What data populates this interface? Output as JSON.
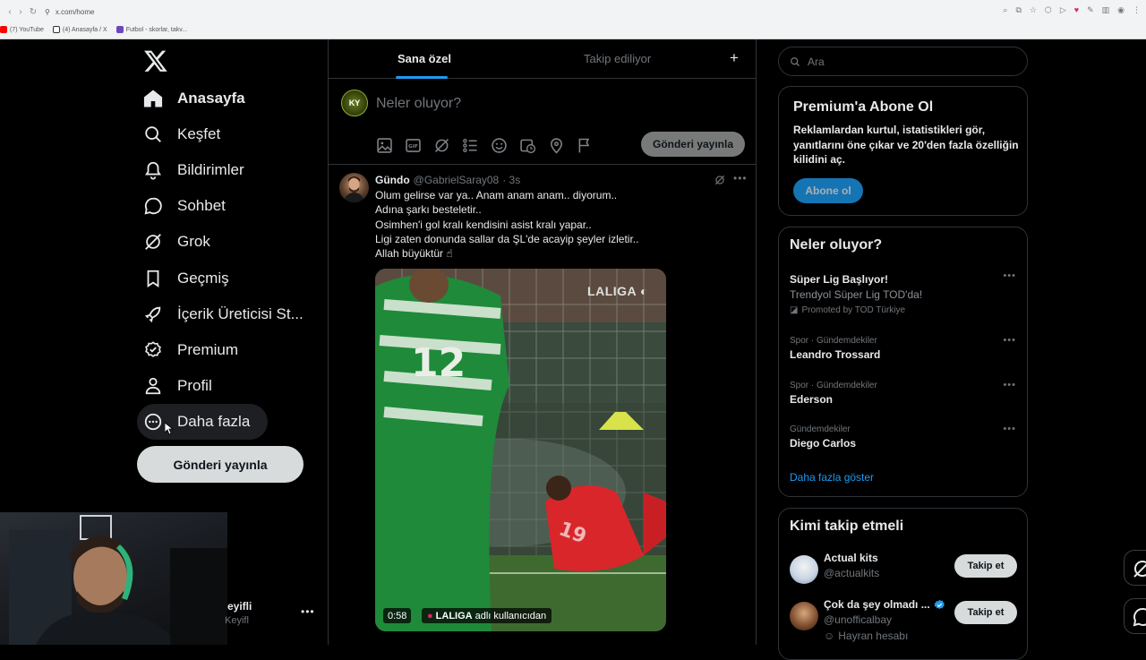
{
  "browser": {
    "url": "x.com/home",
    "bookmarks": [
      {
        "label": "(7) YouTube",
        "color": "#ff0000"
      },
      {
        "label": "(4) Anasayfa / X",
        "color": "#ffffff"
      },
      {
        "label": "Futbol - skorlar, takv...",
        "color": "#6b46c1"
      }
    ]
  },
  "sidebar": {
    "items": [
      {
        "label": "Anasayfa",
        "icon": "home-icon"
      },
      {
        "label": "Keşfet",
        "icon": "search-icon"
      },
      {
        "label": "Bildirimler",
        "icon": "bell-icon"
      },
      {
        "label": "Sohbet",
        "icon": "chat-icon"
      },
      {
        "label": "Grok",
        "icon": "grok-icon"
      },
      {
        "label": "Geçmiş",
        "icon": "bookmark-icon"
      },
      {
        "label": "İçerik Üreticisi St...",
        "icon": "rocket-icon"
      },
      {
        "label": "Premium",
        "icon": "verified-icon"
      },
      {
        "label": "Profil",
        "icon": "person-icon"
      },
      {
        "label": "Daha fazla",
        "icon": "more-circle-icon"
      }
    ],
    "post_button": "Gönderi yayınla",
    "account": {
      "name": "eyifli",
      "handle": "Keyifl"
    }
  },
  "feed": {
    "tabs": [
      "Sana özel",
      "Takip ediliyor"
    ],
    "active_tab": 0,
    "compose": {
      "avatar_text": "KY",
      "placeholder": "Neler oluyor?",
      "post_button": "Gönderi yayınla"
    },
    "tweet": {
      "name": "Gündo",
      "handle": "@GabrielSaray08",
      "time": "· 3s",
      "text": "Olum gelirse var ya.. Anam anam anam.. diyorum..\nAdına şarkı besteletir..\nOsimhen'i gol kralı kendisini asist kralı yapar..\nLigi zaten donunda sallar da ŞL'de acayip şeyler izletir..\nAllah büyüktür ☝",
      "video": {
        "watermark": "LALIGA",
        "duration": "0:58",
        "source_brand": "LALIGA",
        "source_suffix": "adlı kullanıcıdan"
      }
    }
  },
  "right": {
    "search_placeholder": "Ara",
    "premium": {
      "title": "Premium'a Abone Ol",
      "description": "Reklamlardan kurtul, istatistikleri gör, yanıtlarını öne çıkar ve 20'den fazla özelliğin kilidini aç.",
      "button": "Abone ol"
    },
    "trends": {
      "title": "Neler oluyor?",
      "items": [
        {
          "category": "",
          "title": "Süper Lig Başlıyor!",
          "subtitle": "Trendyol Süper Lig TOD'da!",
          "promo": "Promoted by TOD Türkiye"
        },
        {
          "category": "Spor · Gündemdekiler",
          "title": "Leandro Trossard",
          "subtitle": "",
          "promo": ""
        },
        {
          "category": "Spor · Gündemdekiler",
          "title": "Ederson",
          "subtitle": "",
          "promo": ""
        },
        {
          "category": "Gündemdekiler",
          "title": "Diego Carlos",
          "subtitle": "",
          "promo": ""
        }
      ],
      "show_more": "Daha fazla göster"
    },
    "who_to_follow": {
      "title": "Kimi takip etmeli",
      "items": [
        {
          "name": "Actual kits",
          "handle": "@actualkits",
          "button": "Takip et",
          "verified": false,
          "extra": ""
        },
        {
          "name": "Çok da şey olmadı ...",
          "handle": "@unofficalbay",
          "button": "Takip et",
          "verified": true,
          "extra": "Hayran hesabı"
        }
      ]
    }
  },
  "colors": {
    "accent": "#1d9bf0",
    "background": "#000000",
    "border": "#2f3336",
    "muted": "#71767b"
  }
}
